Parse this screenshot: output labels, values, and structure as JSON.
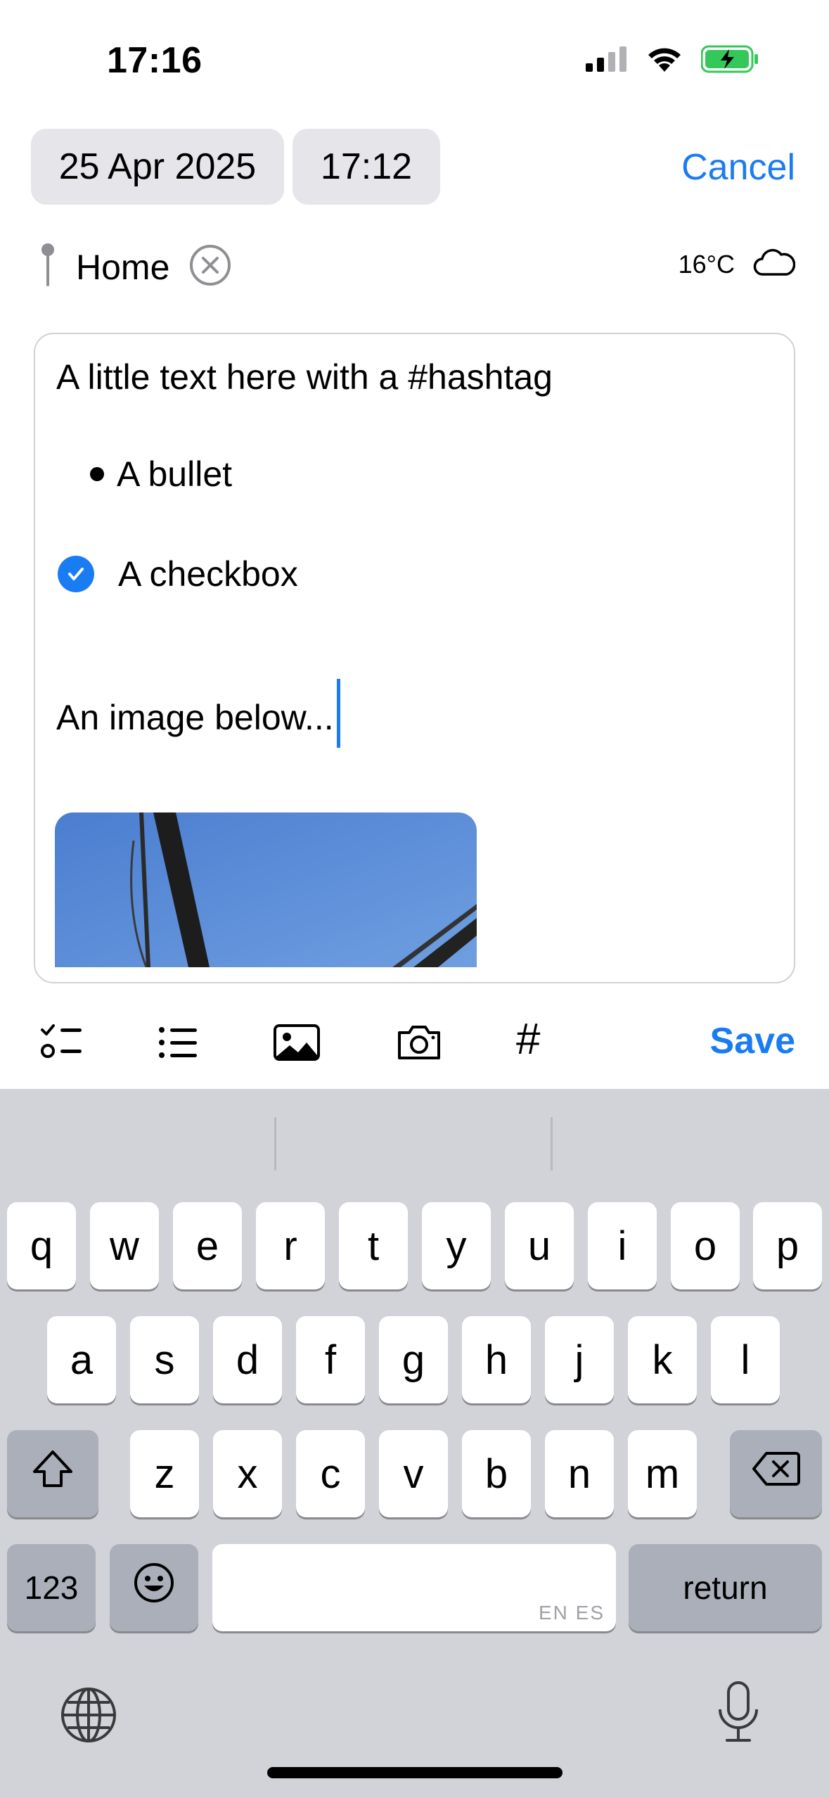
{
  "status_bar": {
    "time": "17:16",
    "signal_icon": "cellular-signal-icon",
    "wifi_icon": "wifi-icon",
    "battery_icon": "battery-charging-icon",
    "battery_color": "#34c759"
  },
  "header": {
    "date": "25 Apr 2025",
    "time": "17:12",
    "cancel_label": "Cancel"
  },
  "location": {
    "label": "Home",
    "pin_icon": "location-pin-icon",
    "clear_icon": "clear-location-icon"
  },
  "weather": {
    "temperature": "16°C",
    "icon": "cloud-icon"
  },
  "editor": {
    "line1": "A little text here with a #hashtag",
    "bullet_text": "A bullet",
    "checkbox_text": "A checkbox",
    "checkbox_checked": true,
    "line4": "An image below...",
    "image_alt_icon": "attached-photo"
  },
  "toolbar": {
    "items": [
      "checklist-icon",
      "bullet-list-icon",
      "photo-library-icon",
      "camera-icon",
      "hashtag-icon"
    ],
    "hashtag_symbol": "#",
    "save_label": "Save"
  },
  "keyboard": {
    "row1": [
      "q",
      "w",
      "e",
      "r",
      "t",
      "y",
      "u",
      "i",
      "o",
      "p"
    ],
    "row2": [
      "a",
      "s",
      "d",
      "f",
      "g",
      "h",
      "j",
      "k",
      "l"
    ],
    "row3": [
      "z",
      "x",
      "c",
      "v",
      "b",
      "n",
      "m"
    ],
    "numbers_label": "123",
    "space_hint": "EN ES",
    "return_label": "return",
    "shift_icon": "shift-icon",
    "delete_icon": "delete-icon",
    "emoji_icon": "emoji-icon",
    "globe_icon": "globe-icon",
    "mic_icon": "microphone-icon"
  },
  "colors": {
    "accent": "#1a7cf2",
    "pill_bg": "#e5e5ea",
    "keyboard_bg": "#d1d3d9"
  }
}
